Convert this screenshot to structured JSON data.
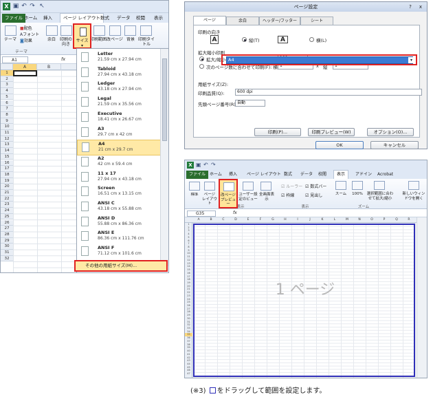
{
  "left": {
    "quick_access": {
      "app_icon": "excel-icon",
      "icons": [
        "save-icon",
        "undo-icon",
        "redo-icon",
        "cursor-icon"
      ]
    },
    "tabs": [
      "ファイル",
      "ホーム",
      "挿入",
      "ページ レイアウト",
      "数式",
      "データ",
      "校閲",
      "表示"
    ],
    "active_tab": "ページ レイアウト",
    "ribbon": {
      "theme_label": "テーマ",
      "colors_label": "配色",
      "fonts_label": "フォント",
      "effects_label": "効果",
      "group_theme": "テーマ",
      "margins_label": "余白",
      "orientation_label": "印刷の向き",
      "size_label": "サイズ",
      "print_area_label": "印刷範囲",
      "breaks_label": "改ページ",
      "background_label": "背景",
      "print_titles_label": "印刷タイトル"
    },
    "name_box": "A1",
    "fx": "fx",
    "columns": [
      "A",
      "B"
    ],
    "rows": [
      "1",
      "2",
      "3",
      "4",
      "5",
      "6",
      "7",
      "8",
      "9",
      "10",
      "11",
      "12",
      "13",
      "14",
      "15",
      "16",
      "17",
      "18",
      "19",
      "20",
      "21",
      "22",
      "23",
      "24",
      "25",
      "26",
      "27",
      "28",
      "29",
      "30",
      "31",
      "32"
    ],
    "paper_sizes": [
      {
        "name": "Letter",
        "dims": "21.59 cm x 27.94 cm"
      },
      {
        "name": "Tabloid",
        "dims": "27.94 cm x 43.18 cm"
      },
      {
        "name": "Ledger",
        "dims": "43.18 cm x 27.94 cm"
      },
      {
        "name": "Legal",
        "dims": "21.59 cm x 35.56 cm"
      },
      {
        "name": "Executive",
        "dims": "18.41 cm x 26.67 cm"
      },
      {
        "name": "A3",
        "dims": "29.7 cm x 42 cm"
      },
      {
        "name": "A4",
        "dims": "21 cm x 29.7 cm"
      },
      {
        "name": "A2",
        "dims": "42 cm x 59.4 cm"
      },
      {
        "name": "11 x 17",
        "dims": "27.94 cm x 43.18 cm"
      },
      {
        "name": "Screen",
        "dims": "16.51 cm x 13.15 cm"
      },
      {
        "name": "ANSI C",
        "dims": "43.18 cm x 55.88 cm"
      },
      {
        "name": "ANSI D",
        "dims": "55.88 cm x 86.36 cm"
      },
      {
        "name": "ANSI E",
        "dims": "86.36 cm x 111.76 cm"
      },
      {
        "name": "ANSI F",
        "dims": "71.12 cm x 101.6 cm"
      }
    ],
    "selected_paper": "A4",
    "more_sizes": "その他の用紙サイズ(M)..."
  },
  "dialog": {
    "title": "ページ設定",
    "help": "?",
    "close": "x",
    "tabs": [
      "ページ",
      "余白",
      "ヘッダー/フッター",
      "シート"
    ],
    "orientation_label": "印刷の向き",
    "portrait": "縦(T)",
    "landscape": "横(L)",
    "scaling_label": "拡大縮小印刷",
    "zoom_label": "拡大/縮小(A):",
    "zoom_value": "100",
    "percent": "%",
    "fit_label": "次のページ数に合わせて印刷(F): 横",
    "fit_w": "1",
    "fit_x": "x",
    "fit_tall_label": "縦",
    "fit_h": "1",
    "paper_size_label": "用紙サイズ(Z):",
    "paper_size_value": "A4",
    "quality_label": "印刷品質(Q):",
    "quality_value": "600 dpi",
    "first_page_label": "先頭ページ番号(R):",
    "first_page_value": "自動",
    "print_btn": "印刷(P)...",
    "preview_btn": "印刷プレビュー(W)",
    "options_btn": "オプション(O)...",
    "ok_btn": "OK",
    "cancel_btn": "キャンセル"
  },
  "bottom": {
    "tabs": [
      "ファイル",
      "ホーム",
      "挿入",
      "ページ レイアウト",
      "数式",
      "データ",
      "校閲",
      "表示",
      "アドイン",
      "Acrobat"
    ],
    "active_tab": "表示",
    "normal_label": "標準",
    "page_layout_label": "ページ レイアウト",
    "page_break_label": "改ページ プレビュー",
    "custom_view_label": "ユーザー設定のビュー",
    "fullscreen_label": "全画面表示",
    "ruler_label": "ルーラー",
    "formula_bar_label": "数式バー",
    "gridlines_label": "枠線",
    "headings_label": "見出し",
    "zoom_label": "ズーム",
    "zoom100_label": "100%",
    "zoom_sel_label": "選択範囲に合わせて拡大/縮小",
    "new_window_label": "新しいウィンドウを開く",
    "group_book_view": "ブックの表示",
    "group_show": "表示",
    "group_zoom": "ズーム",
    "name_box": "G35",
    "fx": "fx",
    "columns": [
      "A",
      "B",
      "C",
      "D",
      "E",
      "F",
      "G",
      "H",
      "I",
      "J",
      "K",
      "L",
      "M",
      "N",
      "O",
      "P",
      "Q",
      "R"
    ],
    "rows": [
      "1",
      "2",
      "3",
      "4",
      "5",
      "6",
      "7",
      "8",
      "9",
      "10",
      "11",
      "12",
      "13",
      "14",
      "15",
      "16",
      "17",
      "18",
      "19",
      "20",
      "21",
      "22",
      "23",
      "24",
      "25",
      "26",
      "27",
      "28",
      "29",
      "30",
      "31",
      "32",
      "33",
      "34",
      "35",
      "36",
      "37",
      "38",
      "39",
      "40",
      "41",
      "42",
      "43",
      "44",
      "45",
      "46",
      "47"
    ],
    "page_label": "1 ページ"
  },
  "caption": {
    "prefix": "(※3)",
    "text": "をドラッグして範囲を設定します。"
  },
  "colors": {
    "highlight_red": "#e02020",
    "excel_green": "#2a6e2e",
    "print_area_blue": "#2f2fb8",
    "selection_blue": "#3b7bd4"
  }
}
